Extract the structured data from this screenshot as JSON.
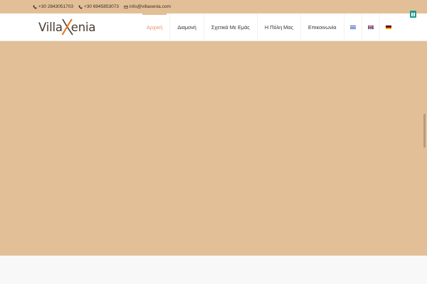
{
  "topbar": {
    "phone1": "+30 2843051703",
    "phone2": "+30 6945853073",
    "email": "info@villaxenia.com",
    "background_color": "#e3bf97"
  },
  "logo": {
    "part1": "Villa",
    "part2": "enia"
  },
  "nav": {
    "items": [
      {
        "label": "Αρχική",
        "active": true
      },
      {
        "label": "Διαμονή"
      },
      {
        "label": "Σχετικά Με Εμάς"
      },
      {
        "label": "Η Πόλη Μας"
      },
      {
        "label": "Επικοινωνία"
      }
    ],
    "languages": [
      "greek-flag",
      "uk-flag",
      "german-flag"
    ],
    "active_color": "#e0946a"
  },
  "slider": {
    "pause_icon": "pause-icon",
    "pause_color": "#1f9a8f",
    "background_color": "#e3bf97"
  }
}
